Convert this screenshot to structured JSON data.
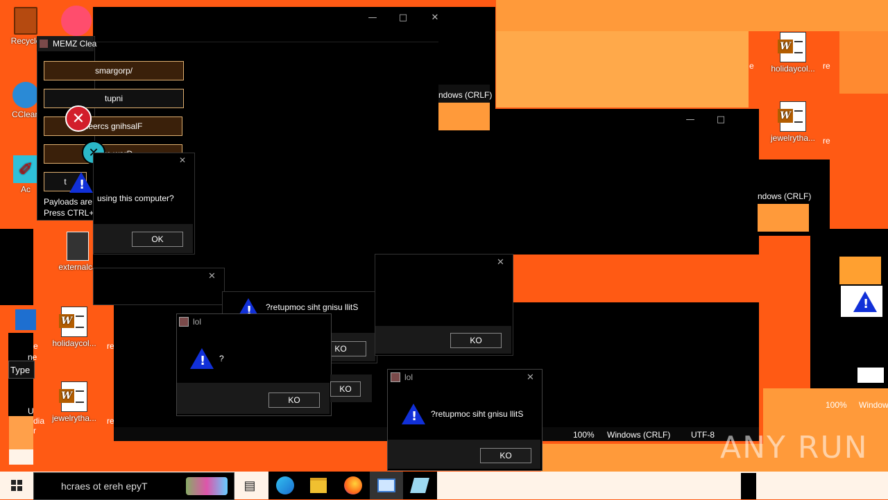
{
  "desktop": {
    "icons": {
      "recycle_bin": "Recycle",
      "ccleaner": "CClean",
      "acrobat": "Ac",
      "externalcam": "externalca",
      "holidaycol_left": "holidaycol...",
      "jewelrytha_left": "jewelrytha...",
      "holidaycol_right": "holidaycol...",
      "jewelrytha_right": "jewelrytha...",
      "fragment_re": "re",
      "fragment_ia": "ia",
      "fragment_dia": "dia",
      "fragment_e": "e",
      "fragment_ne": "ne",
      "fragment_r": "r",
      "fragment_u": "U"
    },
    "type_label": "Type"
  },
  "memz": {
    "title": "MEMZ Clea",
    "buttons": [
      "smargorp/",
      "tupni",
      "neercs gnihsalF",
      "rorre warD",
      "t"
    ],
    "payloads_line1": "Payloads are c",
    "payloads_line2": "Press CTRL+S"
  },
  "notepad": {
    "encoding_top": "ndows (CRLF)",
    "encoding_mid": "ndows (CRLF)",
    "zoom": "100%",
    "line_ending": "Windows (CRLF)",
    "charset": "UTF-8",
    "zoom_right": "100%",
    "line_ending_right": "Window"
  },
  "dialogs": {
    "using_computer": "using this computer?",
    "ok_label": "OK",
    "ok_reversed": "KO",
    "still_using_reversed": "?retupmoc siht gnisu llitS",
    "lol_title": "lol",
    "partial_q": "?"
  },
  "taskbar": {
    "search_placeholder": "hcraes ot ereh epyT",
    "watermark": "ANY RUN"
  },
  "colors": {
    "desktop_orange": "#ff5a14",
    "glitch_orange": "#ff9a3a",
    "warn_blue": "#1130d8"
  }
}
